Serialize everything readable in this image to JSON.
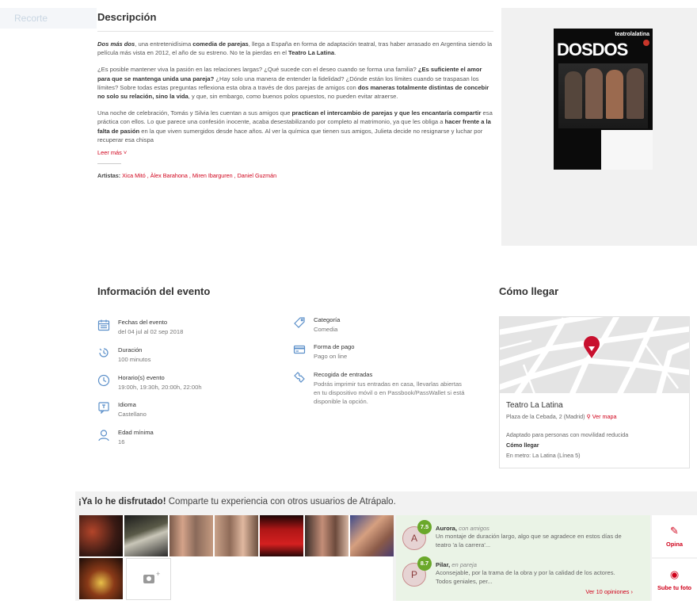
{
  "ghost_tab": "Recorte",
  "description": {
    "title": "Descripción",
    "p1_lead": "Dos más dos",
    "p1_a": ", una entretenidísima ",
    "p1_b": "comedia de parejas",
    "p1_c": ", llega a España en forma de adaptación teatral, tras haber arrasado en Argentina siendo la película más vista en 2012, el año de su estreno. No te la pierdas en el ",
    "p1_d": "Teatro La Latina",
    "p1_e": ".",
    "p2_a": "¿Es posible mantener viva la pasión en las relaciones largas? ¿Qué sucede con el deseo cuando se forma una familia? ",
    "p2_b": "¿Es suficiente el amor para que se mantenga unida una pareja?",
    "p2_c": " ¿Hay solo una manera de entender la fidelidad? ¿Dónde están los límites cuando se traspasan los límites? Sobre todas estas preguntas reflexiona esta obra a través de dos parejas de amigos con ",
    "p2_d": "dos maneras totalmente distintas de concebir no solo su relación, sino la vida",
    "p2_e": ", y que, sin embargo, como buenos polos opuestos, no pueden evitar atraerse.",
    "p3_a": "Una noche de celebración, Tomás y Silvia les cuentan a sus amigos que ",
    "p3_b": "practican el intercambio de parejas y que les encantaría compartir",
    "p3_c": " esa práctica con ellos. Lo que parece una confesión inocente, acaba desestabilizando por completo al matrimonio, ya que les obliga a ",
    "p3_d": "hacer frente a la falta de pasión",
    "p3_e": " en la que viven sumergidos desde hace años. Al ver la química que tienen sus amigos, Julieta decide no resignarse y luchar por recuperar esa chispa",
    "read_more": "Leer más ˅",
    "artists_label": "Artistas:",
    "artists": "Xica Mitó , Àlex Barahona , Miren Ibarguren , Daniel Guzmán"
  },
  "poster": {
    "brand": "teatrolalatina",
    "logo": "DOSDOS"
  },
  "event_info": {
    "title": "Información del evento",
    "items": [
      {
        "icon": "calendar-icon",
        "label": "Fechas del evento",
        "value": "del 04 jul al 02 sep 2018"
      },
      {
        "icon": "hourglass-icon",
        "label": "Duración",
        "value": "100 minutos"
      },
      {
        "icon": "clock-icon",
        "label": "Horario(s) evento",
        "value": "19:00h, 19:30h, 20:00h, 22:00h"
      },
      {
        "icon": "language-icon",
        "label": "Idioma",
        "value": "Castellano"
      },
      {
        "icon": "user-icon",
        "label": "Edad mínima",
        "value": "16"
      },
      {
        "icon": "tag-icon",
        "label": "Categoría",
        "value": "Comedia"
      },
      {
        "icon": "card-icon",
        "label": "Forma de pago",
        "value": "Pago on line"
      },
      {
        "icon": "ticket-icon",
        "label": "Recogida de entradas",
        "value": "Podrás imprimir tus entradas en casa, llevarlas abiertas en tu dispositivo móvil o en Passbook/PassWallet si está disponible la opción."
      }
    ]
  },
  "how_to": {
    "title": "Cómo llegar",
    "venue": "Teatro La Latina",
    "address": "Plaza de la Cebada, 2 (Madrid)",
    "map_link": "Ver mapa",
    "accessibility": "Adaptado para personas con movilidad reducida",
    "como_llegar": "Cómo llegar",
    "metro": "En metro: La Latina (Línea 5)"
  },
  "experience": {
    "title_bold": "¡Ya lo he disfrutado!",
    "title_rest": " Comparte tu experiencia con otros usuarios de Atrápalo.",
    "opinions": [
      {
        "initial": "A",
        "score": "7.5",
        "name": "Aurora,",
        "context": "con amigos",
        "text": "Un montaje de duración largo, algo que se agradece en estos días de teatro 'a la carrera'..."
      },
      {
        "initial": "P",
        "score": "8.7",
        "name": "Pilar,",
        "context": "en pareja",
        "text": "Aconsejable, por la trama de la obra y por la calidad de los actores. Todos geniales, per..."
      }
    ],
    "more_opinions": "Ver 10 opiniones ›",
    "opina": "Opina",
    "upload": "Sube tu foto"
  },
  "colors": {
    "accent": "#d0021b",
    "icon_blue": "#5b8fc9",
    "score_green": "#6aa82a"
  }
}
